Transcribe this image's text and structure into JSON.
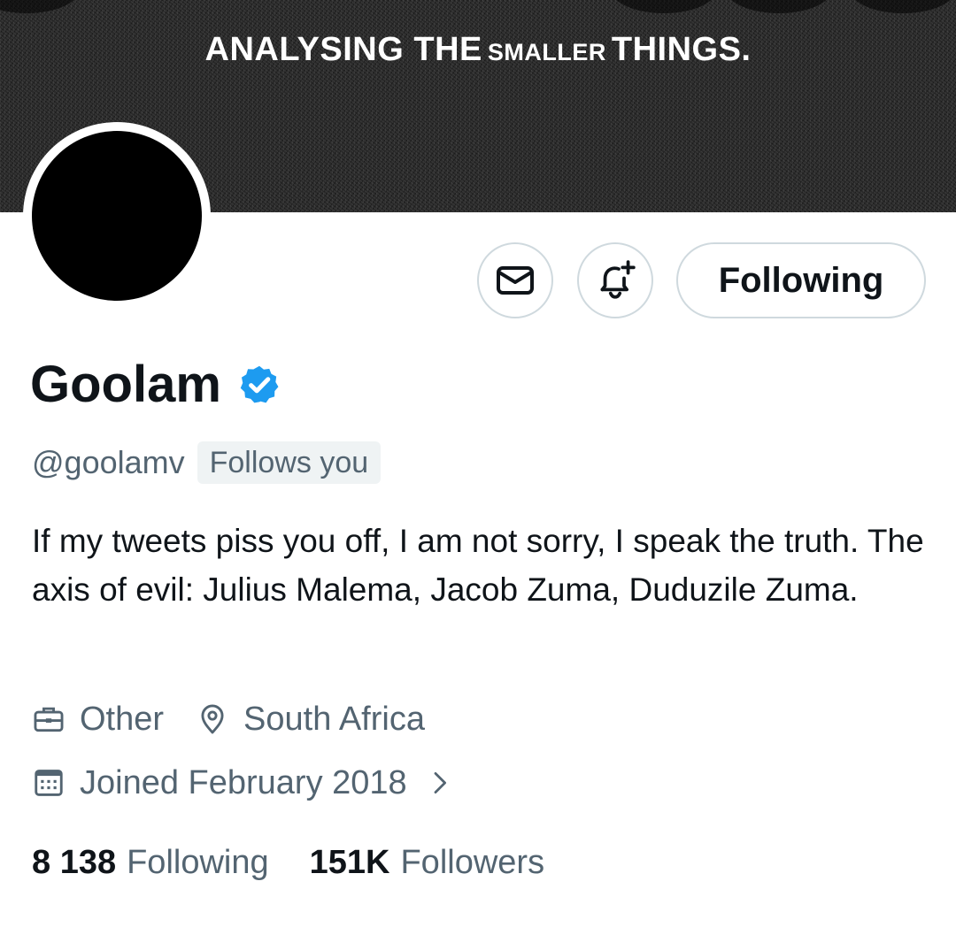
{
  "banner": {
    "text_part1": "ANALYSING THE",
    "text_small": "SMALLER",
    "text_part2": "THINGS."
  },
  "actions": {
    "message_icon": "envelope-icon",
    "notify_icon": "bell-plus-icon",
    "following_label": "Following"
  },
  "profile": {
    "name": "Goolam",
    "verified_icon": "verified-badge-icon",
    "verified_color": "#1d9bf0",
    "handle": "@goolamv",
    "follows_you": "Follows you",
    "bio": "If my tweets piss you off, I am not sorry, I speak the truth. The axis of evil: Julius Malema, Jacob Zuma, Duduzile Zuma.",
    "category": "Other",
    "category_icon": "briefcase-icon",
    "location": "South Africa",
    "location_icon": "location-pin-icon",
    "joined": "Joined February 2018",
    "joined_icon": "calendar-icon",
    "joined_chevron_icon": "chevron-right-icon"
  },
  "stats": {
    "following_count": "8 138",
    "following_label": "Following",
    "followers_count": "151K",
    "followers_label": "Followers"
  },
  "colors": {
    "text_primary": "#0f1419",
    "text_secondary": "#536471",
    "border": "#cfd9de"
  }
}
